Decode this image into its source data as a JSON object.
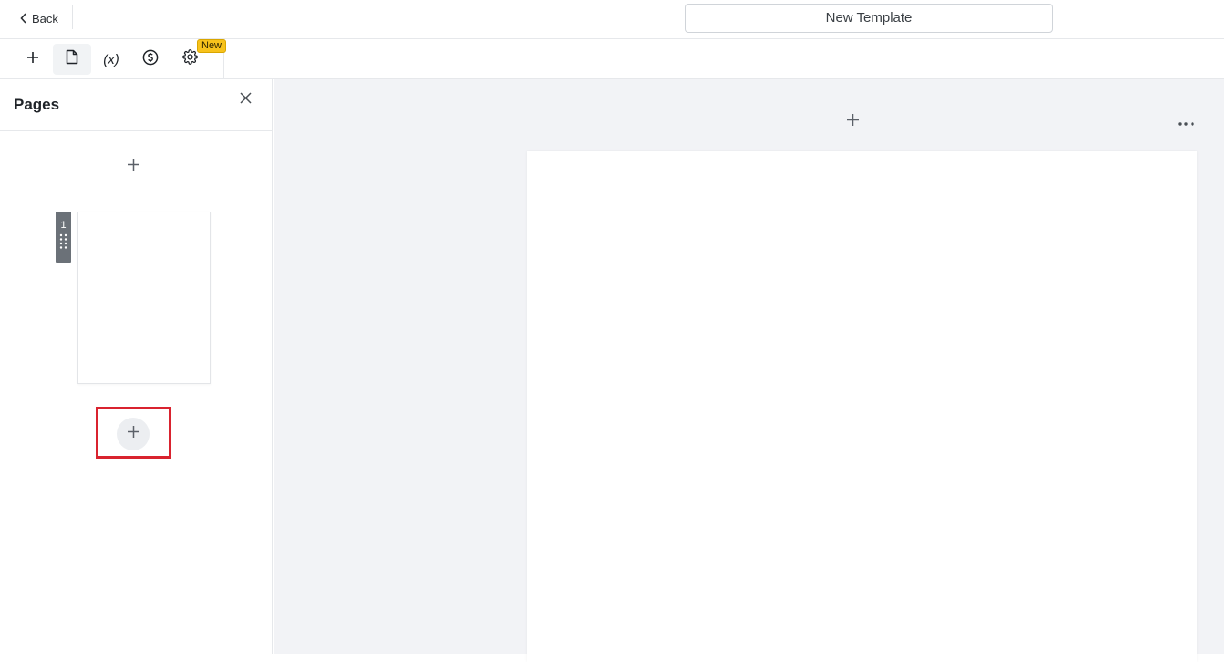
{
  "header": {
    "back_label": "Back",
    "template_title": "New Template"
  },
  "toolbar": {
    "tools": [
      {
        "name": "add",
        "icon": "plus-icon"
      },
      {
        "name": "pages",
        "icon": "page-icon",
        "active": true
      },
      {
        "name": "variables",
        "icon": "variable-icon",
        "label": "(x)"
      },
      {
        "name": "pricing",
        "icon": "dollar-circle-icon"
      },
      {
        "name": "settings",
        "icon": "gear-icon"
      }
    ],
    "new_badge": "New"
  },
  "sidebar": {
    "title": "Pages",
    "pages": [
      {
        "number": "1"
      }
    ]
  },
  "colors": {
    "highlight": "#d9232f",
    "badge": "#f7c21c",
    "canvas_bg": "#f2f3f6",
    "page_handle": "#6b7178"
  }
}
